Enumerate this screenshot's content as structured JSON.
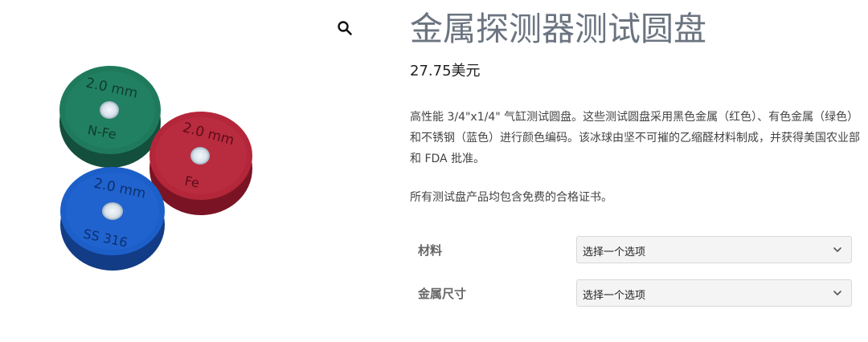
{
  "product": {
    "title": "金属探测器测试圆盘",
    "price": "27.75美元",
    "description": "高性能 3/4\"x1/4\" 气缸测试圆盘。这些测试圆盘采用黑色金属（红色）、有色金属（绿色）和不锈钢（蓝色）进行颜色编码。该冰球由坚不可摧的乙缩醛材料制成，并获得美国农业部和 FDA 批准。",
    "cert_note": "所有测试盘产品均包含免费的合格证书。"
  },
  "image": {
    "pucks": [
      {
        "color": "green",
        "hex": "#1f7a5c",
        "line1": "2.0 mm",
        "line2": "N-Fe"
      },
      {
        "color": "red",
        "hex": "#b4263a",
        "line1": "2.0 mm",
        "line2": "Fe"
      },
      {
        "color": "blue",
        "hex": "#1d5fc9",
        "line1": "2.0 mm",
        "line2": "SS 316"
      }
    ]
  },
  "variations": [
    {
      "label": "材料",
      "selected": "选择一个选项"
    },
    {
      "label": "金属尺寸",
      "selected": "选择一个选项"
    }
  ],
  "icons": {
    "zoom": "magnifier-icon",
    "select_arrow": "chevron-down-icon"
  }
}
